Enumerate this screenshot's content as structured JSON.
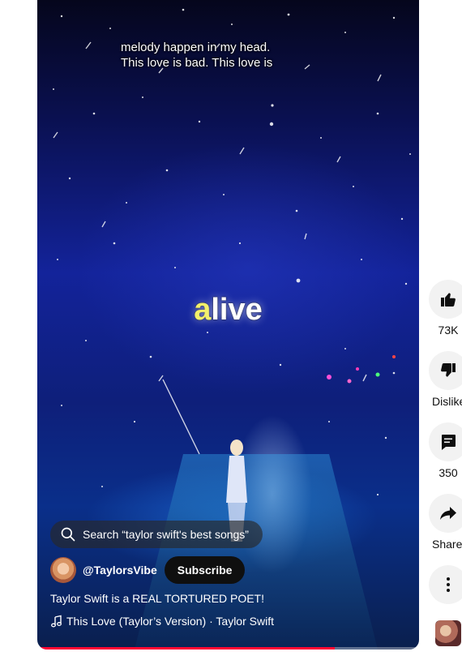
{
  "video": {
    "lyric_line_1": "melody happen in my head.",
    "lyric_line_2": "This love is bad. This love is",
    "lyric_big_highlight": "a",
    "lyric_big_rest": "live",
    "search_text": "Search “taylor swift's best songs”",
    "channel": "@TaylorsVibe",
    "subscribe_label": "Subscribe",
    "title": "Taylor Swift is a REAL TORTURED POET!",
    "music": "This Love (Taylor’s Version) · Taylor Swift",
    "progress_fraction": 0.78
  },
  "actions": {
    "like_count": "73K",
    "dislike_label": "Dislike",
    "comment_count": "350",
    "share_label": "Share"
  },
  "icons": {
    "like": "thumbs-up-icon",
    "dislike": "thumbs-down-icon",
    "comment": "comment-icon",
    "share": "share-arrow-icon",
    "more": "more-vert-icon",
    "search": "search-icon",
    "music": "music-note-icon"
  },
  "colors": {
    "progress": "#ff0033",
    "lyric_highlight": "#f2f06a",
    "subscribe_bg": "#0f0f0f",
    "rail_button_bg": "#f2f2f2"
  }
}
